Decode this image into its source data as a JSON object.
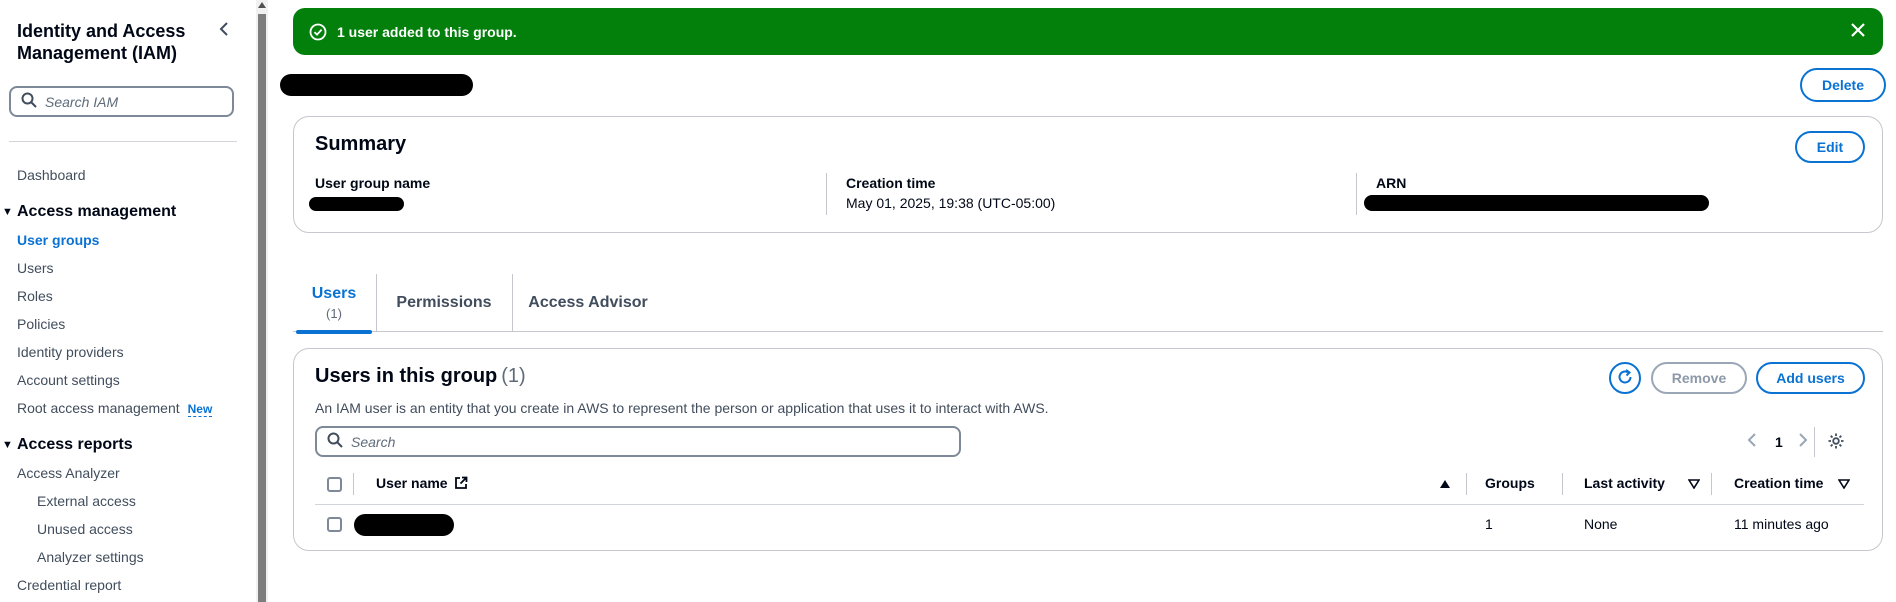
{
  "sidebar": {
    "title": "Identity and Access Management (IAM)",
    "search_placeholder": "Search IAM",
    "dashboard": "Dashboard",
    "access_management": {
      "label": "Access management",
      "items": [
        "User groups",
        "Users",
        "Roles",
        "Policies",
        "Identity providers",
        "Account settings",
        "Root access management"
      ],
      "new_badge": "New"
    },
    "access_reports": {
      "label": "Access reports",
      "items": [
        "Access Analyzer",
        "External access",
        "Unused access",
        "Analyzer settings",
        "Credential report"
      ]
    }
  },
  "flash": {
    "message": "1 user added to this group."
  },
  "page": {
    "delete_label": "Delete"
  },
  "summary": {
    "title": "Summary",
    "edit_label": "Edit",
    "group_name_label": "User group name",
    "creation_time_label": "Creation time",
    "creation_time_value": "May 01, 2025, 19:38 (UTC-05:00)",
    "arn_label": "ARN"
  },
  "tabs": [
    {
      "label": "Users",
      "count": "(1)"
    },
    {
      "label": "Permissions"
    },
    {
      "label": "Access Advisor"
    }
  ],
  "users_table": {
    "title": "Users in this group",
    "count": "(1)",
    "description": "An IAM user is an entity that you create in AWS to represent the person or application that uses it to interact with AWS.",
    "remove_label": "Remove",
    "add_label": "Add users",
    "search_placeholder": "Search",
    "page": "1",
    "columns": [
      "User name",
      "Groups",
      "Last activity",
      "Creation time"
    ],
    "rows": [
      {
        "groups": "1",
        "last_activity": "None",
        "creation_time": "11 minutes ago"
      }
    ]
  },
  "colors": {
    "accent": "#0972d3",
    "success": "#037f0c",
    "text": "#000716"
  }
}
